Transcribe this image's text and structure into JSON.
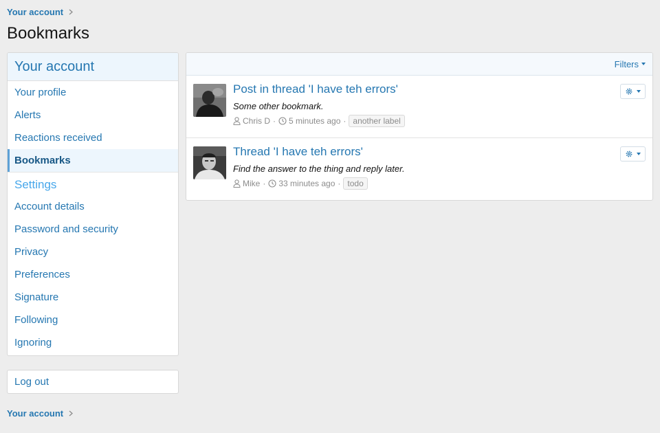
{
  "breadcrumb": {
    "label": "Your account"
  },
  "page": {
    "title": "Bookmarks"
  },
  "sidebar": {
    "header": "Your account",
    "account_items": [
      {
        "label": "Your profile"
      },
      {
        "label": "Alerts"
      },
      {
        "label": "Reactions received"
      },
      {
        "label": "Bookmarks",
        "active": true
      }
    ],
    "settings_header": "Settings",
    "settings_items": [
      {
        "label": "Account details"
      },
      {
        "label": "Password and security"
      },
      {
        "label": "Privacy"
      },
      {
        "label": "Preferences"
      },
      {
        "label": "Signature"
      },
      {
        "label": "Following"
      },
      {
        "label": "Ignoring"
      }
    ],
    "logout": "Log out"
  },
  "filters": {
    "label": "Filters"
  },
  "bookmarks": [
    {
      "title": "Post in thread 'I have teh errors'",
      "snippet": "Some other bookmark.",
      "user": "Chris D",
      "time": "5 minutes ago",
      "label": "another label"
    },
    {
      "title": "Thread 'I have teh errors'",
      "snippet": "Find the answer to the thing and reply later.",
      "user": "Mike",
      "time": "33 minutes ago",
      "label": "todo"
    }
  ],
  "icons": {
    "user": "user-icon",
    "clock": "clock-icon",
    "gear": "gear-icon",
    "chevron": "chevron-right-icon"
  },
  "colors": {
    "link": "#2577b1",
    "accent_bg": "#edf6fd",
    "page_bg": "#ededed",
    "active_border": "#5ea1d6"
  }
}
